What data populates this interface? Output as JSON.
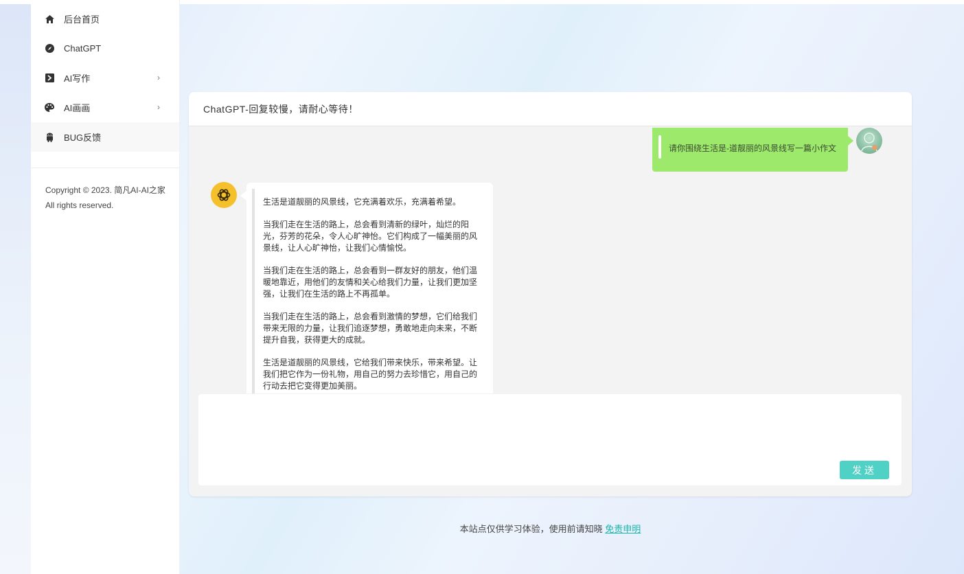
{
  "sidebar": {
    "items": [
      {
        "label": "后台首页",
        "icon": "home-icon"
      },
      {
        "label": "ChatGPT",
        "icon": "compass-icon"
      },
      {
        "label": "AI写作",
        "icon": "terminal-icon",
        "arrow": "›"
      },
      {
        "label": "AI画画",
        "icon": "palette-icon",
        "arrow": "›"
      },
      {
        "label": "BUG反馈",
        "icon": "android-icon"
      }
    ],
    "copyright": "Copyright © 2023. 简凡AI-AI之家 All rights reserved."
  },
  "chat": {
    "header": "ChatGPT-回复较慢，请耐心等待！",
    "user_message": "请你围绕生活是-道靓丽的风景线写一篇小作文",
    "bot_paragraphs": [
      "生活是道靓丽的风景线，它充满着欢乐，充满着希望。",
      "当我们走在生活的路上，总会看到清新的绿叶，灿烂的阳光，芬芳的花朵，令人心旷神怡。它们构成了一幅美丽的风景线，让人心旷神怡，让我们心情愉悦。",
      "当我们走在生活的路上，总会看到一群友好的朋友，他们温暖地靠近，用他们的友情和关心给我们力量，让我们更加坚强，让我们在生活的路上不再孤单。",
      "当我们走在生活的路上，总会看到激情的梦想，它们给我们带来无限的力量，让我们追逐梦想，勇敢地走向未来，不断提升自我，获得更大的成就。",
      "生活是道靓丽的风景线，它给我们带来快乐，带来希望。让我们把它作为一份礼物，用自己的努力去珍惜它，用自己的行动去把它变得更加美丽。"
    ],
    "input_value": "",
    "send_label": "发送"
  },
  "footer": {
    "text": "本站点仅供学习体验，使用前请知晓 ",
    "link": "免责申明"
  },
  "colors": {
    "user_bubble": "#9ce96b",
    "send_button": "#4fd1c5",
    "bot_avatar": "#f4c02b",
    "link": "#19b5a8"
  }
}
